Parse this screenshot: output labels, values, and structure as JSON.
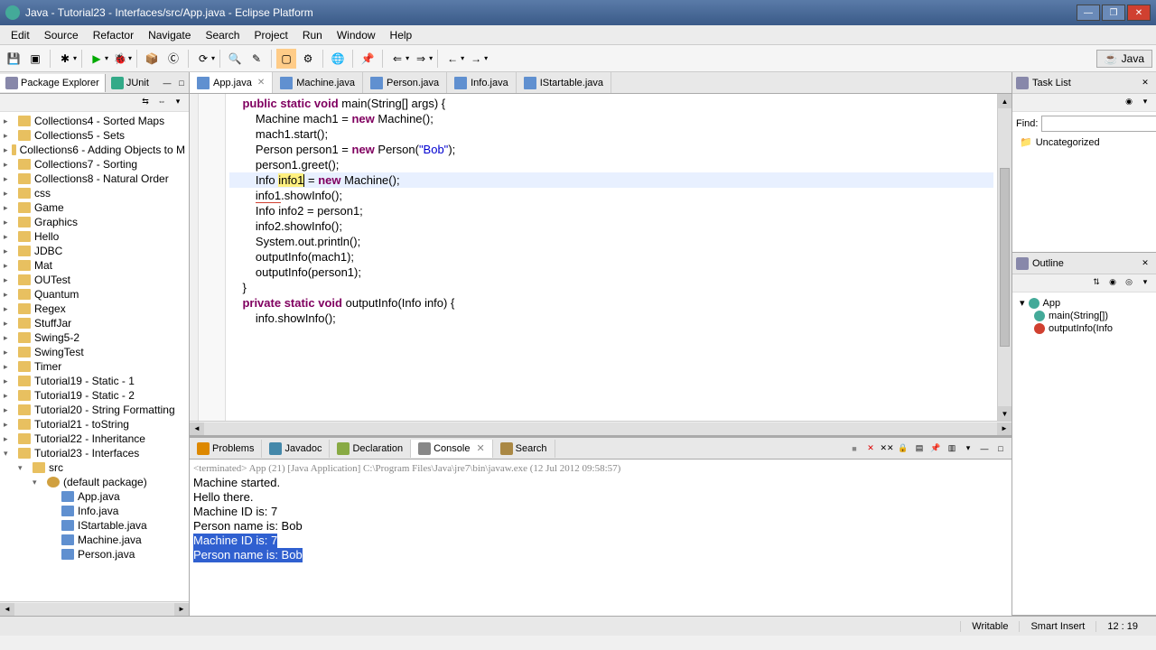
{
  "window": {
    "title": "Java - Tutorial23 - Interfaces/src/App.java - Eclipse Platform"
  },
  "menu": {
    "items": [
      "Edit",
      "Source",
      "Refactor",
      "Navigate",
      "Search",
      "Project",
      "Run",
      "Window",
      "Help"
    ]
  },
  "perspective": {
    "label": "Java"
  },
  "package_explorer": {
    "title": "Package Explorer",
    "junit_tab": "JUnit",
    "items": [
      {
        "label": "Collections4 - Sorted Maps",
        "depth": 0,
        "icon": "folder"
      },
      {
        "label": "Collections5 - Sets",
        "depth": 0,
        "icon": "folder"
      },
      {
        "label": "Collections6 - Adding Objects to M",
        "depth": 0,
        "icon": "folder"
      },
      {
        "label": "Collections7 - Sorting",
        "depth": 0,
        "icon": "folder"
      },
      {
        "label": "Collections8 - Natural Order",
        "depth": 0,
        "icon": "folder"
      },
      {
        "label": "css",
        "depth": 0,
        "icon": "folder"
      },
      {
        "label": "Game",
        "depth": 0,
        "icon": "folder"
      },
      {
        "label": "Graphics",
        "depth": 0,
        "icon": "folder"
      },
      {
        "label": "Hello",
        "depth": 0,
        "icon": "folder"
      },
      {
        "label": "JDBC",
        "depth": 0,
        "icon": "folder"
      },
      {
        "label": "Mat",
        "depth": 0,
        "icon": "folder"
      },
      {
        "label": "OUTest",
        "depth": 0,
        "icon": "folder"
      },
      {
        "label": "Quantum",
        "depth": 0,
        "icon": "folder"
      },
      {
        "label": "Regex",
        "depth": 0,
        "icon": "folder"
      },
      {
        "label": "StuffJar",
        "depth": 0,
        "icon": "folder"
      },
      {
        "label": "Swing5-2",
        "depth": 0,
        "icon": "folder"
      },
      {
        "label": "SwingTest",
        "depth": 0,
        "icon": "folder"
      },
      {
        "label": "Timer",
        "depth": 0,
        "icon": "folder"
      },
      {
        "label": "Tutorial19 - Static - 1",
        "depth": 0,
        "icon": "folder"
      },
      {
        "label": "Tutorial19 - Static - 2",
        "depth": 0,
        "icon": "folder"
      },
      {
        "label": "Tutorial20 - String Formatting",
        "depth": 0,
        "icon": "folder"
      },
      {
        "label": "Tutorial21 - toString",
        "depth": 0,
        "icon": "folder"
      },
      {
        "label": "Tutorial22 - Inheritance",
        "depth": 0,
        "icon": "folder"
      },
      {
        "label": "Tutorial23 - Interfaces",
        "depth": 0,
        "icon": "folder",
        "expanded": true
      },
      {
        "label": "src",
        "depth": 1,
        "icon": "folder",
        "expanded": true
      },
      {
        "label": "(default package)",
        "depth": 2,
        "icon": "pkg",
        "expanded": true
      },
      {
        "label": "App.java",
        "depth": 3,
        "icon": "java"
      },
      {
        "label": "Info.java",
        "depth": 3,
        "icon": "java"
      },
      {
        "label": "IStartable.java",
        "depth": 3,
        "icon": "java"
      },
      {
        "label": "Machine.java",
        "depth": 3,
        "icon": "java"
      },
      {
        "label": "Person.java",
        "depth": 3,
        "icon": "java"
      }
    ]
  },
  "editor": {
    "tabs": [
      {
        "label": "App.java",
        "active": true
      },
      {
        "label": "Machine.java",
        "active": false
      },
      {
        "label": "Person.java",
        "active": false
      },
      {
        "label": "Info.java",
        "active": false
      },
      {
        "label": "IStartable.java",
        "active": false
      }
    ],
    "code": {
      "l1": "    public static void main(String[] args) {",
      "l2": "",
      "l3": "        Machine mach1 = new Machine();",
      "l4": "        mach1.start();",
      "l5": "",
      "l6": "        Person person1 = new Person(\"Bob\");",
      "l7": "        person1.greet();",
      "l8": "",
      "l9a": "        Info ",
      "l9b": "info1",
      "l9c": " = new Machine();",
      "l10a": "        ",
      "l10b": "info1",
      "l10c": ".showInfo();",
      "l11": "",
      "l12": "        Info info2 = person1;",
      "l13": "        info2.showInfo();",
      "l14": "",
      "l15": "        System.out.println();",
      "l16": "",
      "l17": "        outputInfo(mach1);",
      "l18": "        outputInfo(person1);",
      "l19": "    }",
      "l20": "",
      "l21": "    private static void outputInfo(Info info) {",
      "l22": "        info.showInfo();"
    }
  },
  "bottom": {
    "tabs": [
      {
        "label": "Problems",
        "active": false
      },
      {
        "label": "Javadoc",
        "active": false
      },
      {
        "label": "Declaration",
        "active": false
      },
      {
        "label": "Console",
        "active": true
      },
      {
        "label": "Search",
        "active": false
      }
    ],
    "console": {
      "status": "<terminated> App (21) [Java Application] C:\\Program Files\\Java\\jre7\\bin\\javaw.exe (12 Jul 2012 09:58:57)",
      "lines": [
        "Machine started.",
        "Hello there.",
        "Machine ID is: 7",
        "Person name is: Bob",
        ""
      ],
      "selected": [
        "Machine ID is: 7",
        "Person name is: Bob"
      ]
    }
  },
  "tasklist": {
    "title": "Task List",
    "find_label": "Find:",
    "uncategorized": "Uncategorized"
  },
  "outline": {
    "title": "Outline",
    "items": [
      {
        "label": "App",
        "depth": 0,
        "color": "#4a9"
      },
      {
        "label": "main(String[])",
        "depth": 1,
        "color": "#4a9"
      },
      {
        "label": "outputInfo(Info",
        "depth": 1,
        "color": "#d04030"
      }
    ]
  },
  "status": {
    "writable": "Writable",
    "insert": "Smart Insert",
    "position": "12 : 19"
  }
}
